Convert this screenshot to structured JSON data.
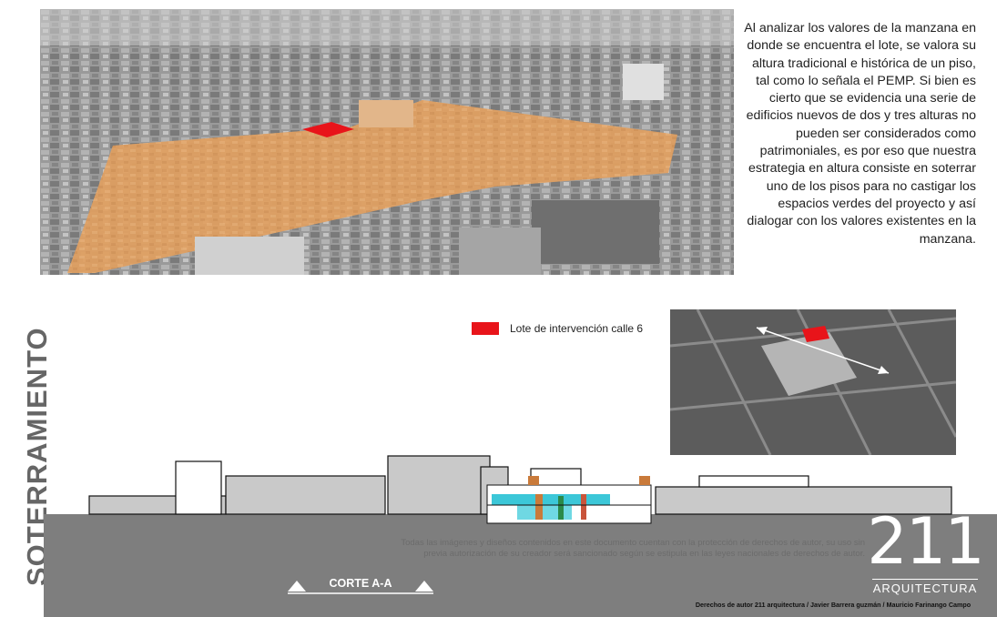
{
  "paragraph": "Al analizar los valores de la manzana en donde se encuentra el lote, se valora su altura tradicional e histórica de un piso, tal como lo señala el PEMP.  Si bien es cierto que se evidencia una serie de edificios nuevos de dos y tres alturas no pueden ser considerados como patrimoniales, es por eso que nuestra estrategia en altura consiste en soterrar uno de los pisos para no castigar los espacios verdes del proyecto y así dialogar con los valores existentes en la manzana.",
  "legend": {
    "label": "Lote de intervención calle 6",
    "color": "#e8141a"
  },
  "side_title": "SOTERRAMIENTO",
  "section_label": "CORTE A-A",
  "fine_print": "Todas las imágenes y diseños contenidos en este documento cuentan con la protección de derechos de autor, su uso sin previa autorización de su creador será sancionado según se estipula en las leyes nacionales de derechos de autor.",
  "logo": {
    "number": "211",
    "text": "ARQUITECTURA"
  },
  "credits": "Derechos de autor 211 arquitectura / Javier Barrera guzmán / Mauricio Farinango Campo",
  "colors": {
    "block_highlight": "#e8a766",
    "lot_highlight": "#e8141a",
    "ground": "#7e7e7e",
    "glass": "#3cc7d8"
  }
}
